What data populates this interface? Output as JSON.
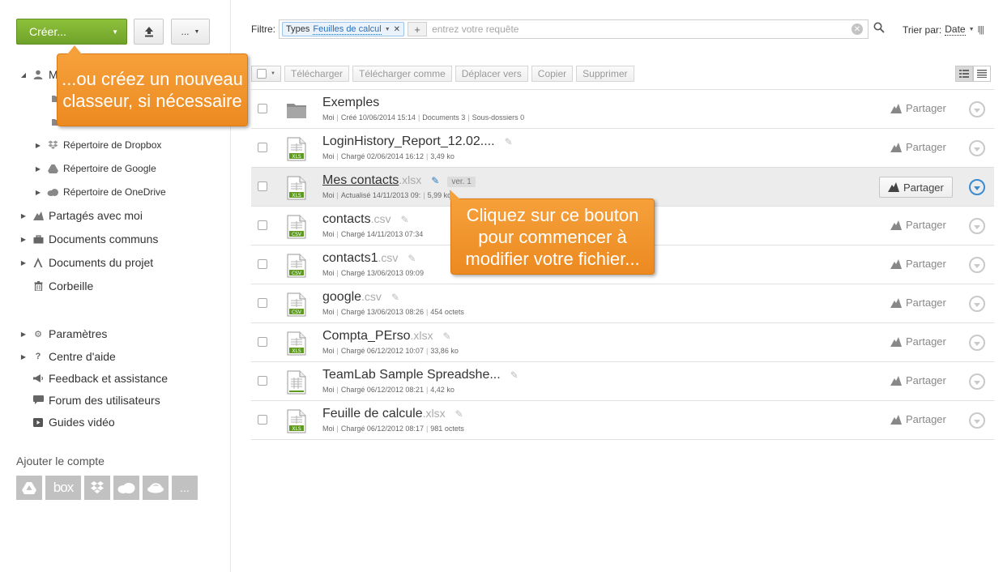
{
  "toolbar_top": {
    "create_label": "Créer...",
    "more_label": "..."
  },
  "tree": {
    "root_label": "M",
    "dropbox": "Répertoire de Dropbox",
    "google": "Répertoire de Google",
    "onedrive": "Répertoire de OneDrive",
    "shared": "Partagés avec moi",
    "common": "Documents communs",
    "projects": "Documents du projet",
    "trash": "Corbeille",
    "settings": "Paramètres",
    "help": "Centre d'aide",
    "feedback": "Feedback et assistance",
    "forum": "Forum des utilisateurs",
    "videos": "Guides vidéo"
  },
  "add_account": {
    "title": "Ajouter le compte",
    "box_label": "box",
    "more_label": "..."
  },
  "filter": {
    "label": "Filtre:",
    "chip_key": "Types",
    "chip_value": "Feuilles de calcul",
    "placeholder": "entrez votre requête"
  },
  "sort": {
    "label": "Trier par:",
    "value": "Date"
  },
  "actions": {
    "download": "Télécharger",
    "download_as": "Télécharger comme",
    "move_to": "Déplacer vers",
    "copy": "Copier",
    "delete": "Supprimer"
  },
  "share_label": "Partager",
  "files": [
    {
      "base": "Exemples",
      "ext": "",
      "type": "folder",
      "owner": "Moi",
      "date": "Créé 10/06/2014 15:14",
      "extra1": "Documents 3",
      "extra2": "Sous-dossiers 0",
      "editable": false,
      "version": ""
    },
    {
      "base": "LoginHistory_Report_12.02....",
      "ext": "",
      "type": "xls",
      "owner": "Moi",
      "date": "Chargé 02/06/2014 16:12",
      "extra1": "3,49 ko",
      "extra2": "",
      "editable": true,
      "version": ""
    },
    {
      "base": "Mes contacts",
      "ext": ".xlsx",
      "type": "xls",
      "owner": "Moi",
      "date": "Actualisé 14/11/2013 09:",
      "extra1": "5,99 ko",
      "extra2": "",
      "editable": true,
      "version": "ver. 1"
    },
    {
      "base": "contacts",
      "ext": ".csv",
      "type": "csv",
      "owner": "Moi",
      "date": "Chargé 14/11/2013 07:34",
      "extra1": "",
      "extra2": "",
      "editable": true,
      "version": ""
    },
    {
      "base": "contacts1",
      "ext": ".csv",
      "type": "csv",
      "owner": "Moi",
      "date": "Chargé 13/06/2013 09:09",
      "extra1": "",
      "extra2": "",
      "editable": true,
      "version": ""
    },
    {
      "base": "google",
      "ext": ".csv",
      "type": "csv",
      "owner": "Moi",
      "date": "Chargé 13/06/2013 08:26",
      "extra1": "454 octets",
      "extra2": "",
      "editable": true,
      "version": ""
    },
    {
      "base": "Compta_PErso",
      "ext": ".xlsx",
      "type": "xls",
      "owner": "Moi",
      "date": "Chargé 06/12/2012 10:07",
      "extra1": "33,86 ko",
      "extra2": "",
      "editable": true,
      "version": ""
    },
    {
      "base": "TeamLab Sample Spreadshe...",
      "ext": "",
      "type": "sheet",
      "owner": "Moi",
      "date": "Chargé 06/12/2012 08:21",
      "extra1": "4,42 ko",
      "extra2": "",
      "editable": true,
      "version": ""
    },
    {
      "base": "Feuille de calcule",
      "ext": ".xlsx",
      "type": "xls",
      "owner": "Moi",
      "date": "Chargé 06/12/2012 08:17",
      "extra1": "981 octets",
      "extra2": "",
      "editable": true,
      "version": ""
    }
  ],
  "callouts": {
    "create_hint": "...ou créez un nouveau classeur, si nécessaire",
    "edit_hint": "Cliquez sur ce bouton pour commencer à modifier votre fichier..."
  },
  "colors": {
    "create_button": "#7ab133",
    "callout": "#f29530",
    "link_blue": "#2a6ebb"
  }
}
